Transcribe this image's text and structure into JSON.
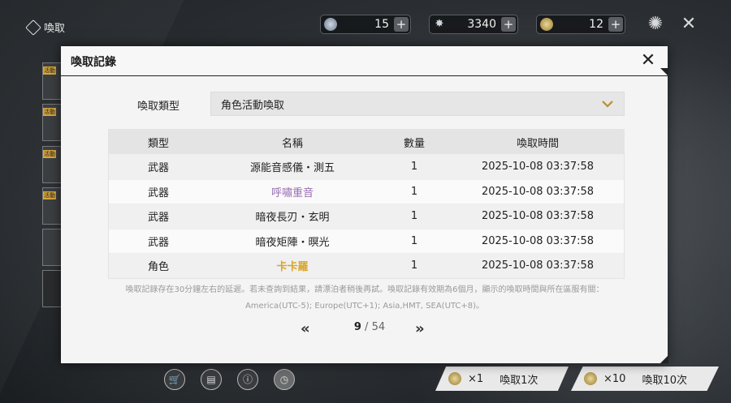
{
  "header": {
    "title": "喚取",
    "currencies": [
      {
        "icon": "ticket-icon",
        "value": "15"
      },
      {
        "icon": "star-crystal-icon",
        "value": "3340"
      },
      {
        "icon": "coin-icon",
        "value": "12"
      }
    ],
    "plus": "+"
  },
  "left_tabs": [
    {
      "tag": "活動"
    },
    {
      "tag": "活動"
    },
    {
      "tag": "活動"
    },
    {
      "tag": "活動"
    }
  ],
  "modal": {
    "title": "喚取記錄",
    "filter_label": "喚取類型",
    "filter_value": "角色活動喚取",
    "table": {
      "headers": [
        "類型",
        "名稱",
        "數量",
        "喚取時間"
      ],
      "rows": [
        {
          "type": "武器",
          "name": "源能音感儀・測五",
          "qty": "1",
          "time": "2025-10-08 03:37:58",
          "rarity": "normal"
        },
        {
          "type": "武器",
          "name": "呼嘯重音",
          "qty": "1",
          "time": "2025-10-08 03:37:58",
          "rarity": "purple"
        },
        {
          "type": "武器",
          "name": "暗夜長刃・玄明",
          "qty": "1",
          "time": "2025-10-08 03:37:58",
          "rarity": "normal"
        },
        {
          "type": "武器",
          "name": "暗夜矩陣・暝光",
          "qty": "1",
          "time": "2025-10-08 03:37:58",
          "rarity": "normal"
        },
        {
          "type": "角色",
          "name": "卡卡羅",
          "qty": "1",
          "time": "2025-10-08 03:37:58",
          "rarity": "gold"
        }
      ]
    },
    "notice_line1": "喚取記錄存在30分鐘左右的延遲。若未查詢到結果，請漂泊者稍後再試。喚取記錄有效期為6個月，顯示的喚取時間與所在區服有關：",
    "notice_line2": "America(UTC-5); Europe(UTC+1); Asia,HMT, SEA(UTC+8)。",
    "pager": {
      "current": "9",
      "separator": " / ",
      "total": "54",
      "prev": "«",
      "next": "»"
    }
  },
  "footer": {
    "pull1": {
      "count": "×1",
      "label": "喚取1次"
    },
    "pull10": {
      "count": "×10",
      "label": "喚取10次"
    }
  },
  "colors": {
    "purple": "#9a6fb3",
    "gold": "#d8a52a"
  }
}
